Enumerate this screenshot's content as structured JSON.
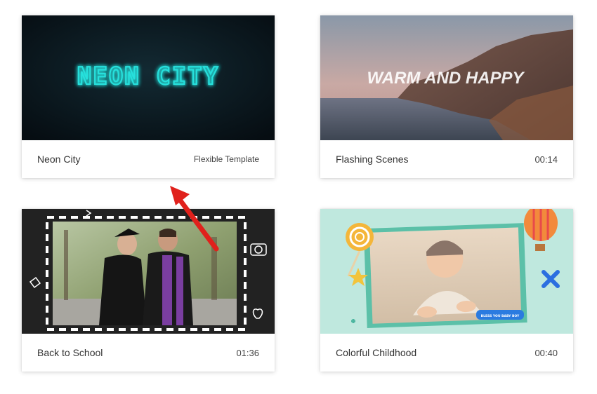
{
  "templates": [
    {
      "title": "Neon City",
      "meta": "Flexible Template",
      "thumb_text": "NEON CITY",
      "accent": "#1fd6d6"
    },
    {
      "title": "Flashing Scenes",
      "meta": "00:14",
      "thumb_text": "WARM AND HAPPY"
    },
    {
      "title": "Back to School",
      "meta": "01:36",
      "thumb_icons": [
        "camera-icon",
        "heart-icon",
        "sparkle-icon",
        "graduation-photo"
      ]
    },
    {
      "title": "Colorful Childhood",
      "meta": "00:40",
      "thumb_badge": "BLESS YOU BABY BOY",
      "thumb_icons": [
        "lollipop-icon",
        "hot-air-balloon-icon",
        "star-icon",
        "cross-icon",
        "plus-icon"
      ]
    }
  ],
  "annotation": {
    "icon": "red-arrow-icon",
    "color": "#e0211c"
  }
}
